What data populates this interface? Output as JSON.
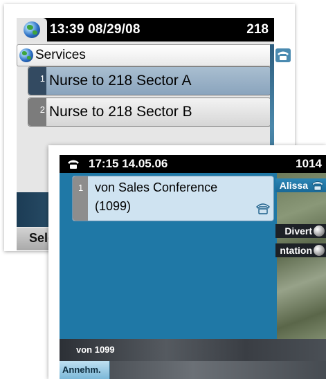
{
  "screen1": {
    "header": {
      "datetime": "13:39 08/29/08",
      "extension": "218"
    },
    "title": "Services",
    "items": [
      {
        "index": "1",
        "label": "Nurse to 218 Sector A",
        "selected": true
      },
      {
        "index": "2",
        "label": "Nurse to 218 Sector B",
        "selected": false
      }
    ],
    "softkey": "Sele"
  },
  "screen2": {
    "header": {
      "datetime": "17:15 14.05.06",
      "extension": "1014"
    },
    "call": {
      "index": "1",
      "line1": "von Sales Conference",
      "line2": "(1099)"
    },
    "side_labels": {
      "top": "Alissa",
      "divert": "Divert",
      "presentation": "ntation"
    },
    "status": "von 1099",
    "softkey": "Annehm."
  },
  "colors": {
    "selected_row": "#8aa4bd",
    "screen2_bg": "#1f78a6",
    "card_bg": "#cfe3f1"
  }
}
